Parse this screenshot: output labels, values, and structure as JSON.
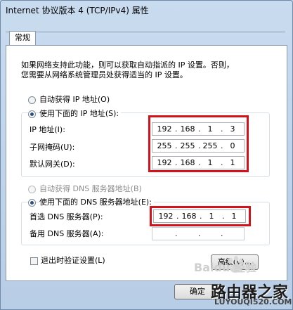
{
  "window": {
    "title": "Internet 协议版本 4 (TCP/IPv4) 属性"
  },
  "tabs": [
    {
      "label": "常规"
    }
  ],
  "description": {
    "line1": "如果网络支持此功能，则可以获取自动指派的 IP 设置。否则，",
    "line2": "您需要从网络系统管理员处获得适当的 IP 设置。"
  },
  "ip_section": {
    "auto_label": "自动获得 IP 地址(O)",
    "manual_label": "使用下面的 IP 地址(S):",
    "selected": "manual",
    "fields": [
      {
        "label": "IP 地址(I):",
        "octets": [
          "192",
          "168",
          "1",
          "3"
        ]
      },
      {
        "label": "子网掩码(U):",
        "octets": [
          "255",
          "255",
          "255",
          "0"
        ]
      },
      {
        "label": "默认网关(D):",
        "octets": [
          "192",
          "168",
          "1",
          "1"
        ]
      }
    ]
  },
  "dns_section": {
    "auto_label": "自动获得 DNS 服务器地址(B)",
    "manual_label": "使用下面的 DNS 服务器地址(E):",
    "selected": "manual",
    "fields": [
      {
        "label": "首选 DNS 服务器(P):",
        "octets": [
          "192",
          "168",
          "1",
          "1"
        ]
      },
      {
        "label": "备用 DNS 服务器(A):",
        "octets": [
          "",
          "",
          "",
          ""
        ]
      }
    ]
  },
  "validate_checkbox": {
    "label": "退出时验证设置(L)",
    "checked": false
  },
  "buttons": {
    "advanced": "高级(V)...",
    "ok": "确定"
  },
  "watermarks": {
    "baidu": "Baidu 经验",
    "site_cn": "路由器之家",
    "site_url": "LUYOUQI520.COM"
  },
  "colors": {
    "highlight_box": "#d4121b",
    "selected_radio": "#2b4f7e"
  },
  "icons": [
    "radio-button",
    "checkbox",
    "baidu-paw-icon"
  ]
}
